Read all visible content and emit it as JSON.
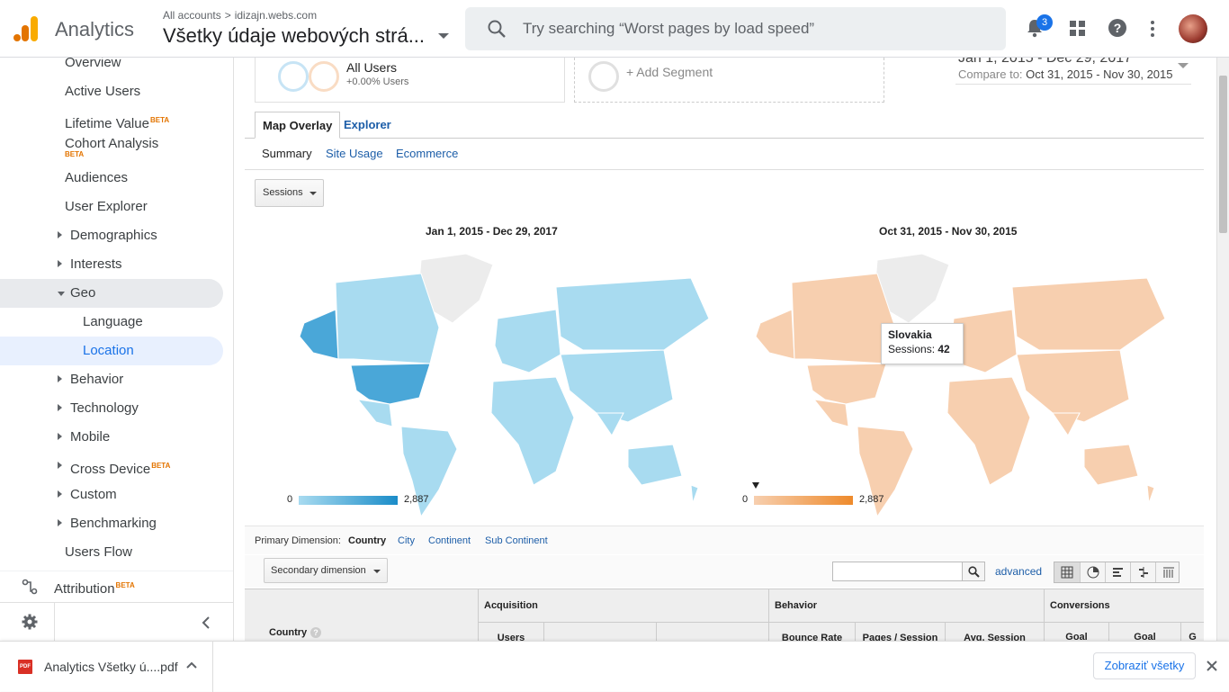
{
  "header": {
    "app_name": "Analytics",
    "breadcrumb_root": "All accounts",
    "breadcrumb_sep": ">",
    "breadcrumb_property": "idizajn.webs.com",
    "view_title": "Všetky údaje webových strá...",
    "search_placeholder": "Try searching “Worst pages by load speed”",
    "notification_count": "3",
    "colors": {
      "logo_orange": "#f9ab00",
      "logo_dark": "#e37400",
      "accent_blue": "#1a73e8"
    }
  },
  "sidebar": {
    "items": [
      {
        "label": "Overview"
      },
      {
        "label": "Active Users"
      },
      {
        "label": "Lifetime Value",
        "badge": "BETA"
      },
      {
        "label": "Cohort Analysis",
        "badge": "BETA"
      },
      {
        "label": "Audiences"
      },
      {
        "label": "User Explorer"
      },
      {
        "label": "Demographics"
      },
      {
        "label": "Interests"
      },
      {
        "label": "Geo"
      },
      {
        "label": "Language"
      },
      {
        "label": "Location"
      },
      {
        "label": "Behavior"
      },
      {
        "label": "Technology"
      },
      {
        "label": "Mobile"
      },
      {
        "label": "Cross Device",
        "badge": "BETA"
      },
      {
        "label": "Custom"
      },
      {
        "label": "Benchmarking"
      },
      {
        "label": "Users Flow"
      }
    ],
    "attribution": {
      "label": "Attribution",
      "badge": "BETA"
    }
  },
  "segments": {
    "all_users": {
      "label": "All Users",
      "sub": "+0.00% Users"
    },
    "add_segment": "+ Add Segment"
  },
  "date_range": {
    "main": "Jan 1, 2015 - Dec 29, 2017",
    "compare_label": "Compare to:",
    "compare_value": "Oct 31, 2015 - Nov 30, 2015"
  },
  "tabs": {
    "map_overlay": "Map Overlay",
    "explorer": "Explorer"
  },
  "subtabs": {
    "summary": "Summary",
    "site_usage": "Site Usage",
    "ecommerce": "Ecommerce"
  },
  "metric_select": "Sessions",
  "maps": {
    "left": {
      "title": "Jan 1, 2015 - Dec 29, 2017",
      "legend_min": "0",
      "legend_max": "2,887",
      "color_light": "#a8dbf0",
      "color_dark": "#1a8cc8"
    },
    "right": {
      "title": "Oct 31, 2015 - Nov 30, 2015",
      "legend_min": "0",
      "legend_max": "2,887",
      "color_light": "#f7cfaf",
      "color_dark": "#ee8a2b"
    }
  },
  "tooltip": {
    "country": "Slovakia",
    "metric_label": "Sessions:",
    "metric_value": "42"
  },
  "dimensions": {
    "label": "Primary Dimension:",
    "country": "Country",
    "city": "City",
    "continent": "Continent",
    "sub_continent": "Sub Continent"
  },
  "table_toolbar": {
    "secondary_dimension": "Secondary dimension",
    "advanced": "advanced"
  },
  "table_header": {
    "country": "Country",
    "help": "?",
    "acquisition": "Acquisition",
    "behavior": "Behavior",
    "conversions": "Conversions",
    "users": "Users",
    "bounce_rate": "Bounce Rate",
    "pages_session": "Pages / Session",
    "avg_session": "Avg. Session",
    "goal1": "Goal",
    "goal2": "Goal",
    "goal3": "G"
  },
  "download_bar": {
    "file_type": "PDF",
    "file_name": "Analytics Všetky ú....pdf",
    "show_all": "Zobraziť všetky"
  }
}
